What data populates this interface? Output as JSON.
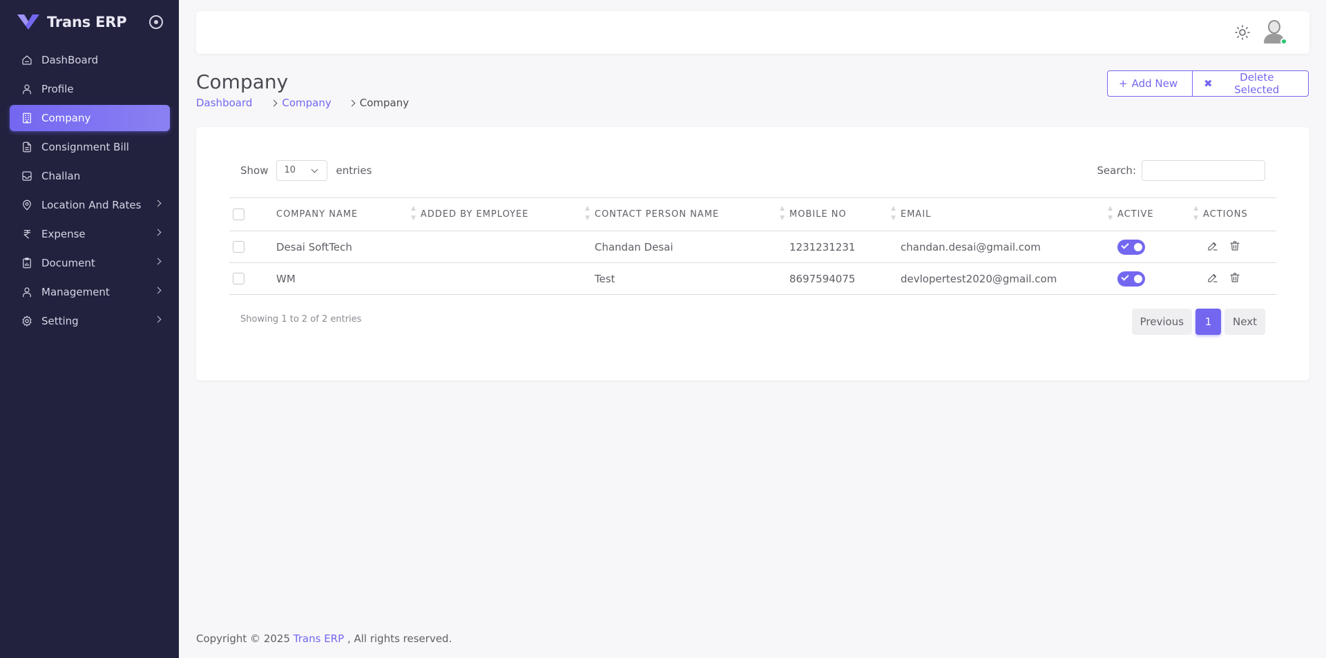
{
  "app": {
    "name": "Trans ERP",
    "accent": "#7367f0",
    "sidebar_bg": "#22223f"
  },
  "sidebar": {
    "items": [
      {
        "label": "DashBoard",
        "icon": "home-icon",
        "active": false,
        "has_submenu": false
      },
      {
        "label": "Profile",
        "icon": "user-icon",
        "active": false,
        "has_submenu": false
      },
      {
        "label": "Company",
        "icon": "building-icon",
        "active": true,
        "has_submenu": false
      },
      {
        "label": "Consignment Bill",
        "icon": "file-icon",
        "active": false,
        "has_submenu": false
      },
      {
        "label": "Challan",
        "icon": "inbox-icon",
        "active": false,
        "has_submenu": false
      },
      {
        "label": "Location And Rates",
        "icon": "map-pin-icon",
        "active": false,
        "has_submenu": true
      },
      {
        "label": "Expense",
        "icon": "rupee-icon",
        "active": false,
        "has_submenu": true
      },
      {
        "label": "Document",
        "icon": "clipboard-icon",
        "active": false,
        "has_submenu": true
      },
      {
        "label": "Management",
        "icon": "user-icon",
        "active": false,
        "has_submenu": true
      },
      {
        "label": "Setting",
        "icon": "gear-icon",
        "active": false,
        "has_submenu": true
      }
    ]
  },
  "header": {
    "title": "Company",
    "breadcrumb": [
      "Dashboard",
      "Company",
      "Company"
    ],
    "add_new_label": "Add New",
    "delete_selected_label": "Delete Selected"
  },
  "table_controls": {
    "show_label": "Show",
    "entries_label": "entries",
    "page_length": "10",
    "search_label": "Search:",
    "search_value": ""
  },
  "table": {
    "columns": [
      "COMPANY NAME",
      "ADDED BY EMPLOYEE",
      "CONTACT PERSON NAME",
      "MOBILE NO",
      "EMAIL",
      "ACTIVE",
      "ACTIONS"
    ],
    "rows": [
      {
        "company_name": "Desai SoftTech",
        "added_by": "",
        "contact_person": "Chandan Desai",
        "mobile": "1231231231",
        "email": "chandan.desai@gmail.com",
        "active": true
      },
      {
        "company_name": "WM",
        "added_by": "",
        "contact_person": "Test",
        "mobile": "8697594075",
        "email": "devlopertest2020@gmail.com",
        "active": true
      }
    ]
  },
  "pagination": {
    "info": "Showing 1 to 2 of 2 entries",
    "previous_label": "Previous",
    "current_page": "1",
    "next_label": "Next"
  },
  "footer": {
    "prefix": "Copyright © 2025",
    "brand": "Trans ERP",
    "suffix": ", All rights reserved."
  }
}
